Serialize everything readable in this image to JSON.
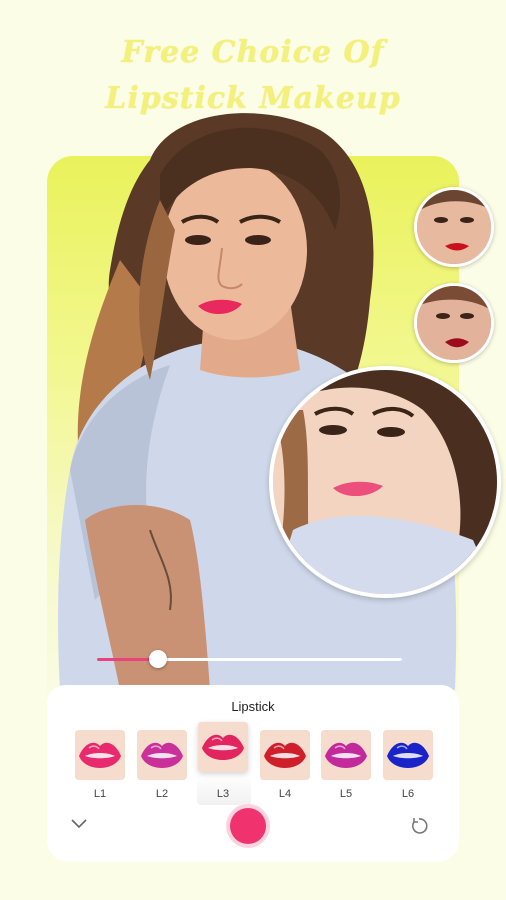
{
  "headline": {
    "line1": "Free Choice Of",
    "line2": "Lipstick Makeup"
  },
  "slider": {
    "value_percent": 20
  },
  "panel": {
    "title": "Lipstick",
    "selected_index": 2,
    "swatches": [
      {
        "label": "L1",
        "color": "#e8296e"
      },
      {
        "label": "L2",
        "color": "#c9309a"
      },
      {
        "label": "L3",
        "color": "#e2245f"
      },
      {
        "label": "L4",
        "color": "#cf1f2a"
      },
      {
        "label": "L5",
        "color": "#c22a9b"
      },
      {
        "label": "L6",
        "color": "#1a23c8"
      }
    ]
  },
  "icons": {
    "collapse": "chevron-down-icon",
    "apply": "apply-color-button",
    "reset": "reset-icon"
  },
  "colors": {
    "accent": "#f0336e",
    "headline": "#f3f07b",
    "background": "#fcfde6"
  }
}
